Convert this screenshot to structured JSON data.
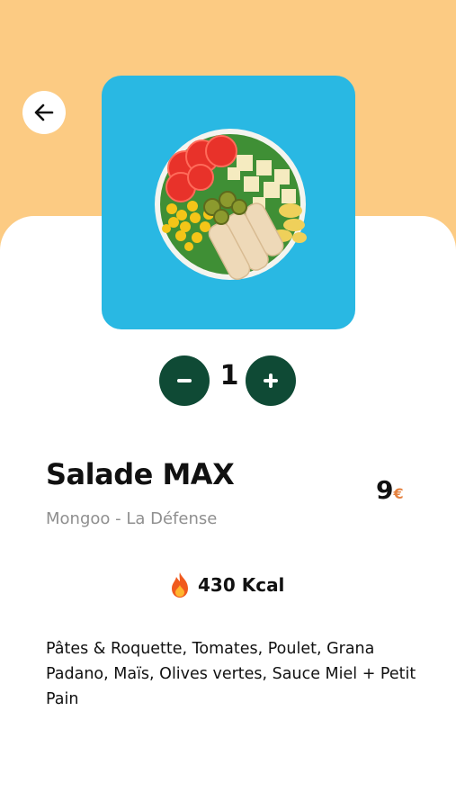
{
  "product": {
    "name": "Salade MAX",
    "restaurant": "Mongoo - La Défense",
    "price": "9",
    "currency": "€",
    "calories": "430 Kcal",
    "description": "Pâtes & Roquette, Tomates, Poulet, Grana Padano, Maïs, Olives vertes, Sauce Miel + Petit Pain"
  },
  "quantity": {
    "value": "1"
  },
  "icons": {
    "back": "arrow-left-icon",
    "decrease": "minus-icon",
    "increase": "plus-icon",
    "calories": "flame-icon"
  },
  "colors": {
    "header_background": "#FCCB83",
    "card_background": "#29B8E3",
    "button_green": "#0F4A35",
    "currency_accent": "#E4813F",
    "secondary_text": "#8f8f8f"
  }
}
